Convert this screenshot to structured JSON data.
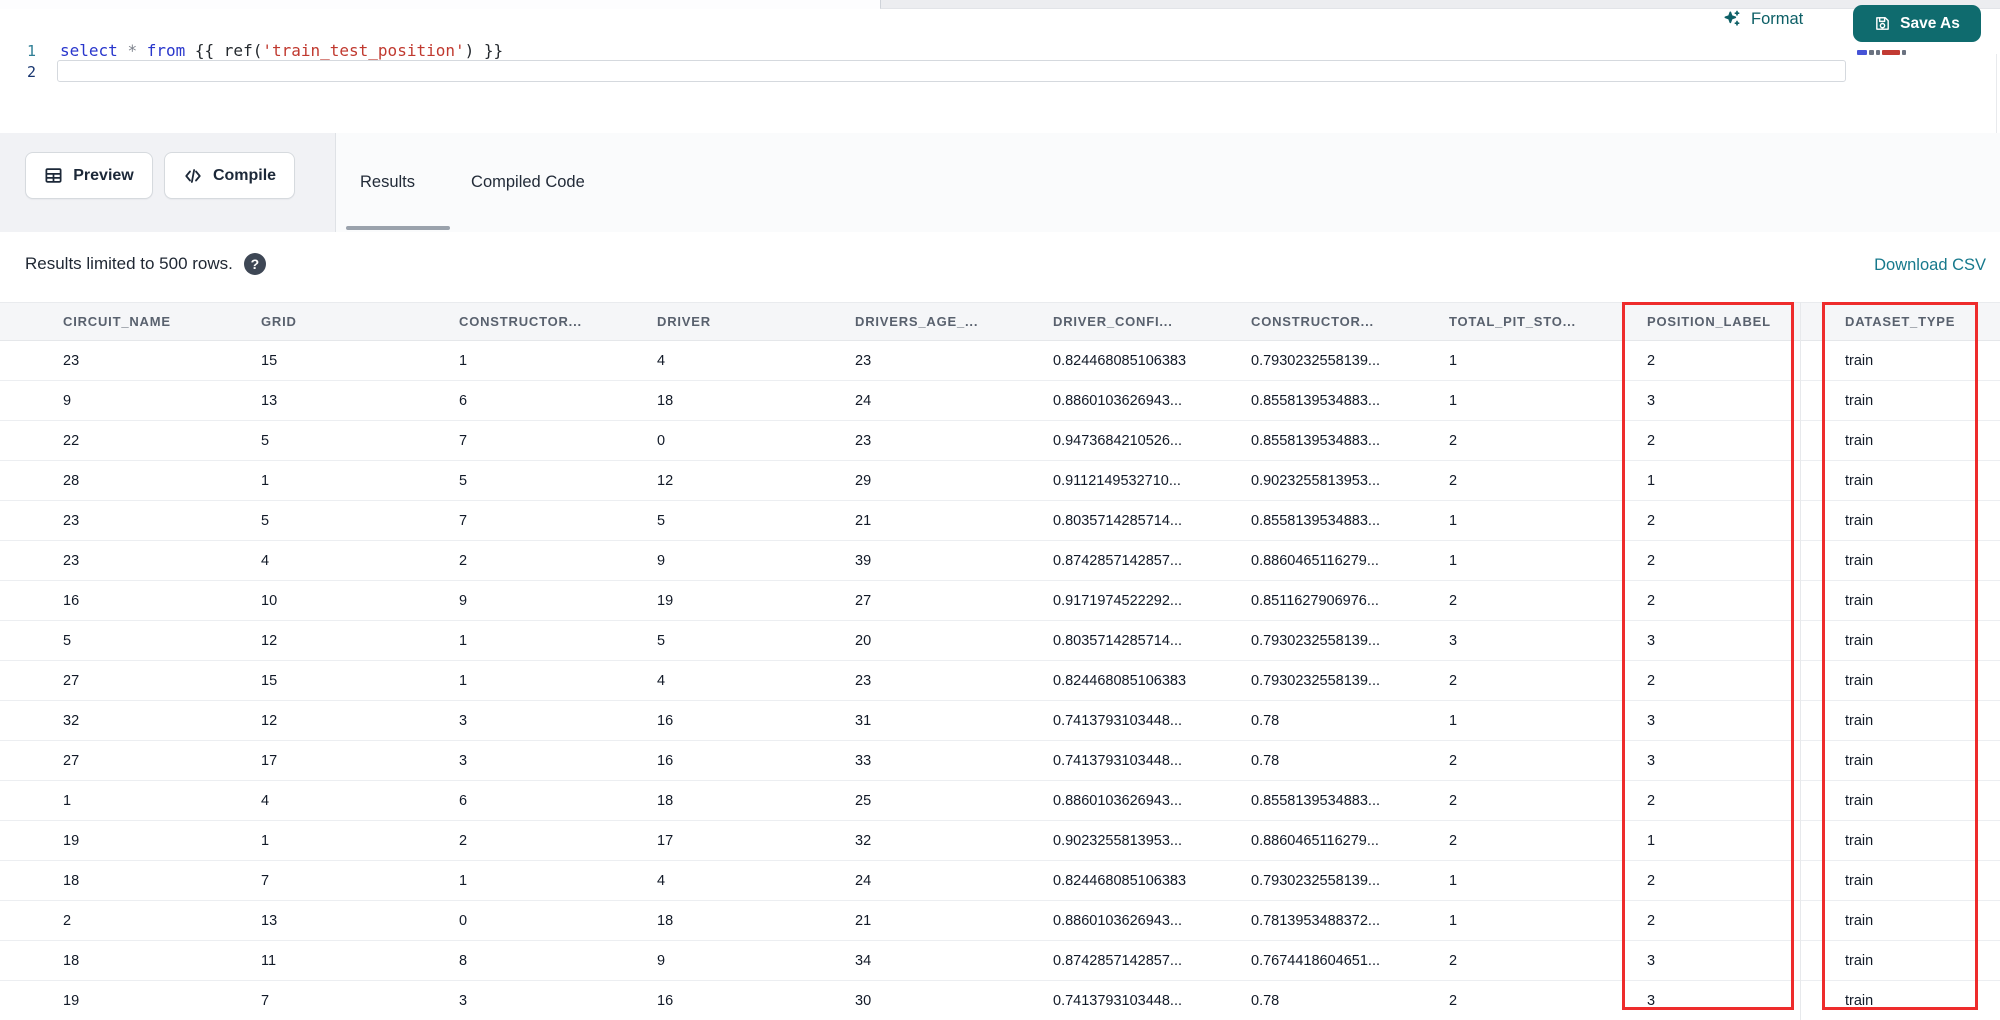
{
  "editor": {
    "lines": [
      {
        "number": "1",
        "tokens": [
          [
            "kw",
            "select"
          ],
          [
            "pn",
            " "
          ],
          [
            "op",
            "*"
          ],
          [
            "pn",
            " "
          ],
          [
            "kw",
            "from"
          ],
          [
            "pn",
            " "
          ],
          [
            "pn",
            "{{"
          ],
          [
            "pn",
            " "
          ],
          [
            "pn",
            "ref("
          ],
          [
            "str",
            "'train_test_position'"
          ],
          [
            "pn",
            ")"
          ],
          [
            "pn",
            " "
          ],
          [
            "pn",
            "}}"
          ]
        ]
      },
      {
        "number": "2",
        "tokens": []
      }
    ],
    "format_label": "Format",
    "save_as_label": "Save As"
  },
  "toolbar": {
    "preview_label": "Preview",
    "compile_label": "Compile",
    "tabs": [
      {
        "label": "Results",
        "active": true
      },
      {
        "label": "Compiled Code",
        "active": false
      }
    ]
  },
  "results": {
    "limit_note": "Results limited to 500 rows.",
    "help_glyph": "?",
    "download_label": "Download CSV"
  },
  "table": {
    "columns": [
      "CIRCUIT_NAME",
      "GRID",
      "CONSTRUCTOR...",
      "DRIVER",
      "DRIVERS_AGE_...",
      "DRIVER_CONFI...",
      "CONSTRUCTOR...",
      "TOTAL_PIT_STO...",
      "POSITION_LABEL",
      "DATASET_TYPE"
    ],
    "rows": [
      [
        "23",
        "15",
        "1",
        "4",
        "23",
        "0.824468085106383",
        "0.7930232558139...",
        "1",
        "2",
        "train"
      ],
      [
        "9",
        "13",
        "6",
        "18",
        "24",
        "0.8860103626943...",
        "0.8558139534883...",
        "1",
        "3",
        "train"
      ],
      [
        "22",
        "5",
        "7",
        "0",
        "23",
        "0.9473684210526...",
        "0.8558139534883...",
        "2",
        "2",
        "train"
      ],
      [
        "28",
        "1",
        "5",
        "12",
        "29",
        "0.9112149532710...",
        "0.9023255813953...",
        "2",
        "1",
        "train"
      ],
      [
        "23",
        "5",
        "7",
        "5",
        "21",
        "0.8035714285714...",
        "0.8558139534883...",
        "1",
        "2",
        "train"
      ],
      [
        "23",
        "4",
        "2",
        "9",
        "39",
        "0.8742857142857...",
        "0.8860465116279...",
        "1",
        "2",
        "train"
      ],
      [
        "16",
        "10",
        "9",
        "19",
        "27",
        "0.9171974522292...",
        "0.8511627906976...",
        "2",
        "2",
        "train"
      ],
      [
        "5",
        "12",
        "1",
        "5",
        "20",
        "0.8035714285714...",
        "0.7930232558139...",
        "3",
        "3",
        "train"
      ],
      [
        "27",
        "15",
        "1",
        "4",
        "23",
        "0.824468085106383",
        "0.7930232558139...",
        "2",
        "2",
        "train"
      ],
      [
        "32",
        "12",
        "3",
        "16",
        "31",
        "0.7413793103448...",
        "0.78",
        "1",
        "3",
        "train"
      ],
      [
        "27",
        "17",
        "3",
        "16",
        "33",
        "0.7413793103448...",
        "0.78",
        "2",
        "3",
        "train"
      ],
      [
        "1",
        "4",
        "6",
        "18",
        "25",
        "0.8860103626943...",
        "0.8558139534883...",
        "2",
        "2",
        "train"
      ],
      [
        "19",
        "1",
        "2",
        "17",
        "32",
        "0.9023255813953...",
        "0.8860465116279...",
        "2",
        "1",
        "train"
      ],
      [
        "18",
        "7",
        "1",
        "4",
        "24",
        "0.824468085106383",
        "0.7930232558139...",
        "1",
        "2",
        "train"
      ],
      [
        "2",
        "13",
        "0",
        "18",
        "21",
        "0.8860103626943...",
        "0.7813953488372...",
        "1",
        "2",
        "train"
      ],
      [
        "18",
        "11",
        "8",
        "9",
        "34",
        "0.8742857142857...",
        "0.7674418604651...",
        "2",
        "3",
        "train"
      ],
      [
        "19",
        "7",
        "3",
        "16",
        "30",
        "0.7413793103448...",
        "0.78",
        "2",
        "3",
        "train"
      ]
    ]
  },
  "annotations": {
    "highlighted_columns": [
      "POSITION_LABEL",
      "DATASET_TYPE"
    ],
    "highlight_color": "#ee2c2c"
  },
  "colors": {
    "accent_teal": "#0f6b6e",
    "link_teal": "#17798c",
    "keyword_blue": "#2936cc",
    "string_red": "#c0392f",
    "tab_underline": "#9aa2ac"
  }
}
